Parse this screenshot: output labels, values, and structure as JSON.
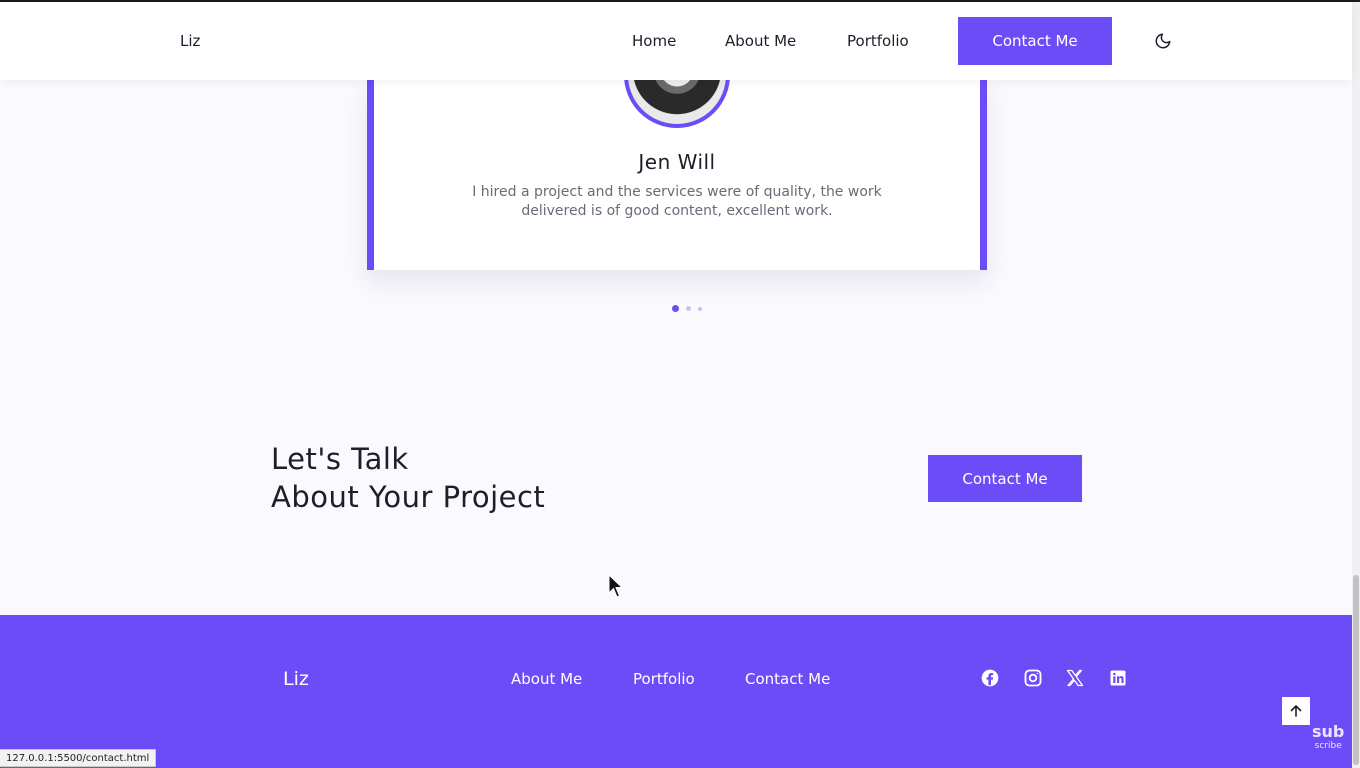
{
  "header": {
    "logo": "Liz",
    "nav": {
      "home": "Home",
      "about": "About Me",
      "portfolio": "Portfolio"
    },
    "contact_button": "Contact Me",
    "theme_toggle_icon": "moon-icon"
  },
  "testimonial": {
    "name": "Jen Will",
    "text": "I hired a project and the services were of quality, the work delivered is of good content, excellent work.",
    "slide_count": 3,
    "active_slide": 1
  },
  "cta": {
    "title_line1": "Let's Talk",
    "title_line2": "About Your Project",
    "button": "Contact Me"
  },
  "footer": {
    "logo": "Liz",
    "links": {
      "about": "About Me",
      "portfolio": "Portfolio",
      "contact": "Contact Me"
    },
    "social_icons": [
      "facebook-icon",
      "instagram-icon",
      "x-icon",
      "linkedin-icon"
    ],
    "back_to_top_icon": "arrow-up-icon",
    "badge": {
      "line1": "sub",
      "line2": "scribe"
    }
  },
  "status_bar": {
    "url": "127.0.0.1:5500/contact.html"
  },
  "colors": {
    "accent": "#6c4cf6",
    "text": "#1e1e2a",
    "muted": "#6a6a78",
    "background": "#faf9fd"
  }
}
